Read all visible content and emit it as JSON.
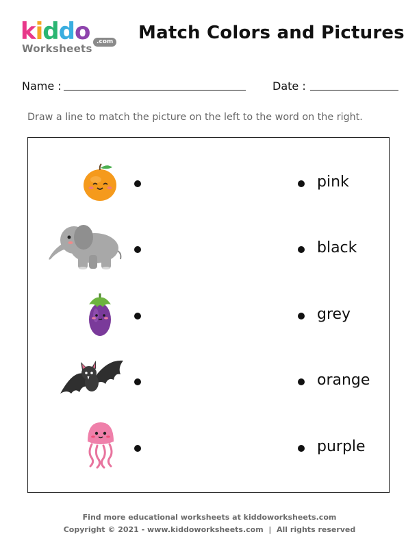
{
  "logo": {
    "brand": "kiddo",
    "sub": "Worksheets",
    "com": ".com",
    "letter_colors": [
      "#e8388a",
      "#f5a623",
      "#2bb673",
      "#3aaee0",
      "#8e44ad"
    ]
  },
  "header": {
    "title": "Match Colors and Pictures"
  },
  "fields": {
    "name_label": "Name :",
    "date_label": "Date :"
  },
  "instructions": "Draw a line to match the picture on the left to the word on the right.",
  "pictures": [
    {
      "icon": "orange-icon"
    },
    {
      "icon": "elephant-icon"
    },
    {
      "icon": "eggplant-icon"
    },
    {
      "icon": "bat-icon"
    },
    {
      "icon": "jellyfish-icon"
    }
  ],
  "words": [
    "pink",
    "black",
    "grey",
    "orange",
    "purple"
  ],
  "footer": {
    "line1": "Find more educational worksheets at kiddoworksheets.com",
    "line2": "Copyright © 2021 - www.kiddoworksheets.com  |  All rights reserved"
  }
}
